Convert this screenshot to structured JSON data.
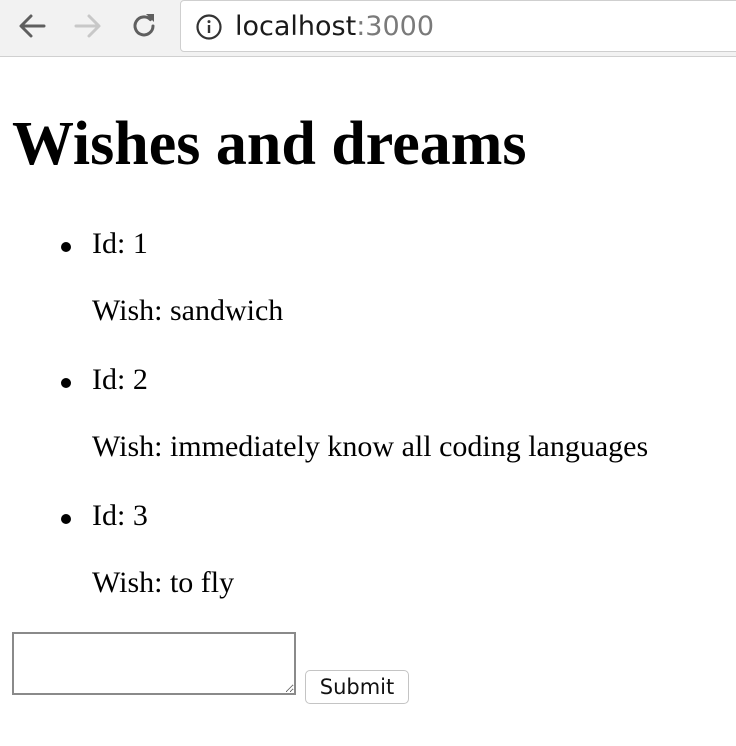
{
  "browser": {
    "address_host": "localhost",
    "address_port": ":3000",
    "back_icon": "arrow-left-icon",
    "forward_icon": "arrow-right-icon",
    "reload_icon": "reload-icon",
    "info_icon": "info-icon"
  },
  "page": {
    "title": "Wishes and dreams",
    "wishes": [
      {
        "id_text": "Id: 1",
        "wish_text": "Wish: sandwich"
      },
      {
        "id_text": "Id: 2",
        "wish_text": "Wish: immediately know all coding languages"
      },
      {
        "id_text": "Id: 3",
        "wish_text": "Wish: to fly"
      }
    ],
    "form": {
      "textarea_value": "",
      "submit_label": "Submit"
    }
  },
  "colors": {
    "toolbar_bg": "#f2f2f2",
    "url_port": "#7a7a7a",
    "nav_forward_disabled": "#c8c8c8"
  }
}
